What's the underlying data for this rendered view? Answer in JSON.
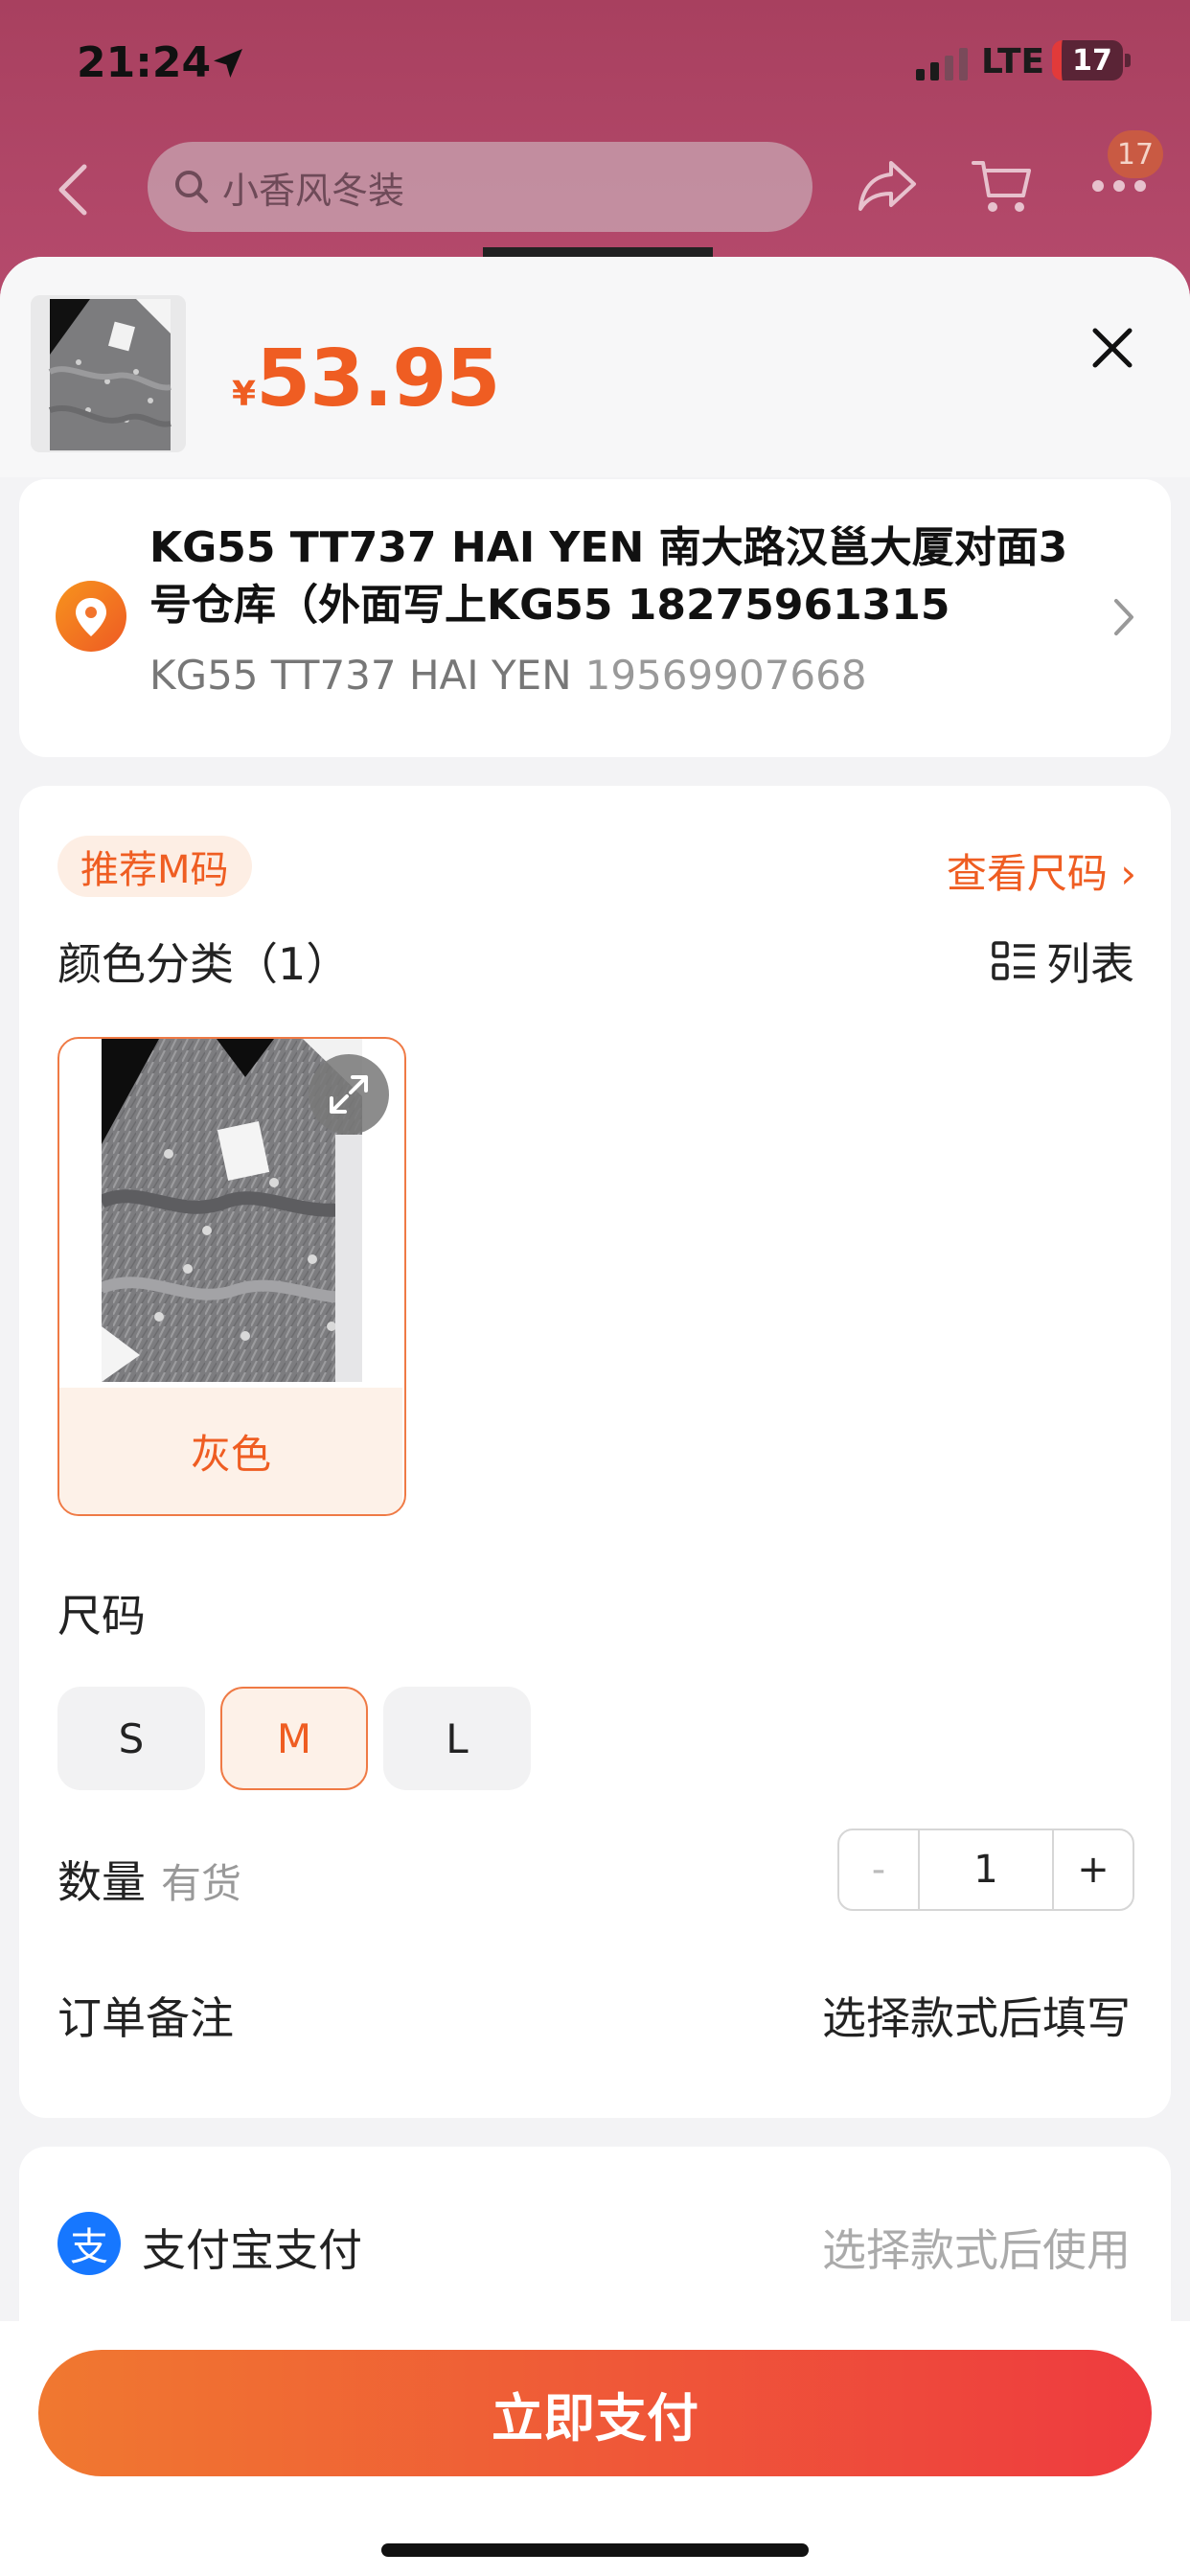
{
  "status_bar": {
    "time": "21:24",
    "network": "LTE",
    "battery": "17"
  },
  "nav": {
    "search_placeholder": "小香风冬装",
    "more_badge": "17"
  },
  "product": {
    "currency": "¥",
    "price": "53.95"
  },
  "address": {
    "name": "KG55 TT737 HAI YEN 南大路汉邕大厦对面3号仓库（外面写上KG55 18275961315",
    "recipient": "KG55 TT737 HAI YEN",
    "phone": "19569907668"
  },
  "sku": {
    "recommend_badge": "推荐M码",
    "size_chart_link": "查看尺码 ›",
    "color_title": "颜色分类（1）",
    "list_toggle": "列表",
    "colors": [
      {
        "label": "灰色",
        "selected": true
      }
    ],
    "size_title": "尺码",
    "sizes": [
      {
        "label": "S",
        "selected": false
      },
      {
        "label": "M",
        "selected": true
      },
      {
        "label": "L",
        "selected": false
      }
    ],
    "quantity_title": "数量",
    "stock_status": "有货",
    "quantity": {
      "minus": "-",
      "value": "1",
      "plus": "+"
    },
    "note_title": "订单备注",
    "note_value": "选择款式后填写"
  },
  "payment": {
    "method_icon": "支",
    "method_label": "支付宝支付",
    "method_hint": "选择款式后使用",
    "pay_button": "立即支付"
  },
  "colors": {
    "accent": "#ef5d22",
    "overlay_bg": "#b54a6c",
    "alipay_blue": "#1677ff"
  }
}
